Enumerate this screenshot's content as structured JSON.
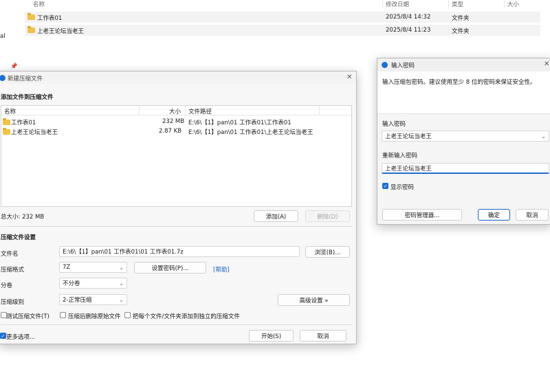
{
  "explorer": {
    "columns": {
      "name": "名称",
      "modified": "修改日期",
      "type": "类型",
      "size": "大小"
    },
    "left_fragment": "al",
    "rows": [
      {
        "name": "工作表01",
        "modified": "2025/8/4 14:32",
        "type": "文件夹"
      },
      {
        "name": "上老王论坛当老王",
        "modified": "2025/8/4 11:23",
        "type": "文件夹"
      }
    ]
  },
  "archive_dialog": {
    "title": "新建压缩文件",
    "add_files_heading": "添加文件到压缩文件",
    "list_headers": {
      "name": "名称",
      "size": "大小",
      "path": "文件路径"
    },
    "files": [
      {
        "name": "工作表01",
        "size": "232 MB",
        "path": "E:\\6\\【1】pan\\01 工作表01\\工作表01"
      },
      {
        "name": "上老王论坛当老王",
        "size": "2.87 KB",
        "path": "E:\\6\\【1】pan\\01 工作表01\\上老王论坛当老王"
      }
    ],
    "total_size": "总大小: 232 MB",
    "add_button": "添加(A)",
    "delete_button": "删除(D)",
    "settings_heading": "压缩文件设置",
    "filename_label": "文件名",
    "filename_value": "E:\\6\\【1】pan\\01 工作表01\\01 工作表01.7z",
    "browse_button": "浏览(B)...",
    "format_label": "压缩格式",
    "format_value": "7Z",
    "set_password_button": "设置密码(P)...",
    "help_link": "[帮助]",
    "split_label": "分卷",
    "split_value": "不分卷",
    "level_label": "压缩级别",
    "level_value": "2-正常压缩",
    "advanced_button": "高级设置 »",
    "test_checkbox": "测试压缩文件(T)",
    "delete_after_checkbox": "压缩后删除原始文件",
    "separate_checkbox": "把每个文件/文件夹添加到独立的压缩文件",
    "more_options": "更多选项...",
    "start_button": "开始(S)",
    "cancel_button": "取消"
  },
  "password_dialog": {
    "title": "输入密码",
    "description": "输入压缩包密码。建议使用至少 8 位的密码来保证安全性。",
    "password_label": "输入密码",
    "password_value": "上老王论坛当老王",
    "confirm_label": "重新输入密码",
    "confirm_value": "上老王论坛当老王",
    "show_password": "显示密码",
    "manager_button": "密码管理器...",
    "ok_button": "确定",
    "cancel_button": "取消"
  }
}
